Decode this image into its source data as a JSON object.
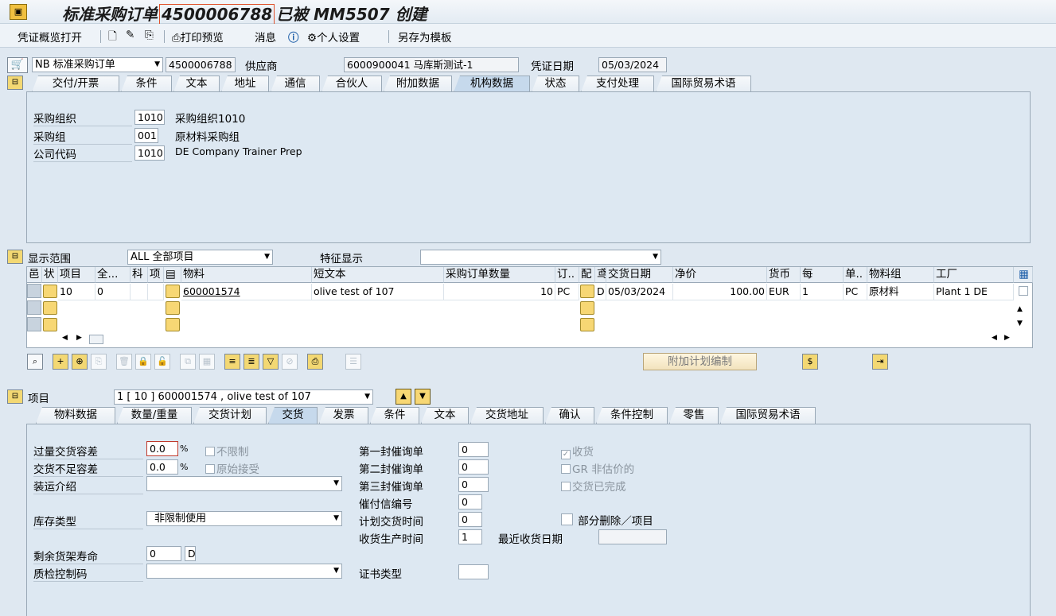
{
  "title": {
    "prefix": "标准采购订单",
    "po_number": "4500006788",
    "mid": "已被",
    "user": "MM5507",
    "suffix": "创建"
  },
  "toolbar": {
    "overview": "凭证概览打开",
    "print_preview": "打印预览",
    "messages": "消息",
    "personal_settings": "个人设置",
    "save_as_template": "另存为模板"
  },
  "header": {
    "doc_type": "NB 标准采购订单",
    "po_number": "4500006788",
    "vendor_label": "供应商",
    "vendor_value": "6000900041 马库斯测试-1",
    "doc_date_label": "凭证日期",
    "doc_date_value": "05/03/2024"
  },
  "header_tabs": [
    "交付/开票",
    "条件",
    "文本",
    "地址",
    "通信",
    "合伙人",
    "附加数据",
    "机构数据",
    "状态",
    "支付处理",
    "国际贸易术语"
  ],
  "org": {
    "purch_org_label": "采购组织",
    "purch_org_code": "1010",
    "purch_org_desc": "采购组织1010",
    "purch_group_label": "采购组",
    "purch_group_code": "001",
    "purch_group_desc": "原材料采购组",
    "company_label": "公司代码",
    "company_code": "1010",
    "company_desc": "DE Company Trainer Prep"
  },
  "items_overview": {
    "range_label": "显示范围",
    "range_value": "ALL 全部项目",
    "char_label": "特征显示",
    "char_value": ""
  },
  "grid": {
    "columns": [
      "邑",
      "状",
      "项目",
      "全...",
      "科",
      "项",
      "",
      "物料",
      "短文本",
      "采购订单数量",
      "订..",
      "配",
      "鸢",
      "交货日期",
      "净价",
      "货币",
      "每",
      "单..",
      "物料组",
      "工厂"
    ],
    "row": {
      "item": "10",
      "full": "0",
      "material": "600001574",
      "short_text": "olive test of 107",
      "quantity": "10",
      "unit": "PC",
      "cat": "D",
      "delivery_date": "05/03/2024",
      "net_price": "100.00",
      "currency": "EUR",
      "per": "1",
      "order_unit": "PC",
      "mat_group": "原材料",
      "plant": "Plant 1 DE"
    }
  },
  "extra_plan_button": "附加计划编制",
  "item_section": {
    "label": "项目",
    "value": "1 [ 10 ] 600001574 , olive test of 107"
  },
  "item_tabs": [
    "物料数据",
    "数量/重量",
    "交货计划",
    "交货",
    "发票",
    "条件",
    "文本",
    "交货地址",
    "确认",
    "条件控制",
    "零售",
    "国际贸易术语"
  ],
  "delivery": {
    "over_tol_label": "过量交货容差",
    "over_tol_value": "0.0",
    "under_tol_label": "交货不足容差",
    "under_tol_value": "0.0",
    "percent": "%",
    "unlimited": "不限制",
    "orig_accept": "原始接受",
    "shipping_label": "装运介绍",
    "stock_type_label": "库存类型",
    "stock_type_value": "非限制使用",
    "shelf_life_label": "剩余货架寿命",
    "shelf_life_value": "0",
    "shelf_life_unit": "D",
    "qi_label": "质检控制码",
    "reminder1_label": "第一封催询单",
    "reminder1_value": "0",
    "reminder2_label": "第二封催询单",
    "reminder2_value": "0",
    "reminder3_label": "第三封催询单",
    "reminder3_value": "0",
    "dunning_label": "催付信编号",
    "dunning_value": "0",
    "plan_deliv_label": "计划交货时间",
    "plan_deliv_value": "0",
    "gr_proc_label": "收货生产时间",
    "gr_proc_value": "1",
    "last_gr_label": "最近收货日期",
    "cert_label": "证书类型",
    "gr_check": "收货",
    "gr_nonval": "GR 非估价的",
    "deliv_complete": "交货已完成",
    "partial_del": "部分删除／项目"
  }
}
